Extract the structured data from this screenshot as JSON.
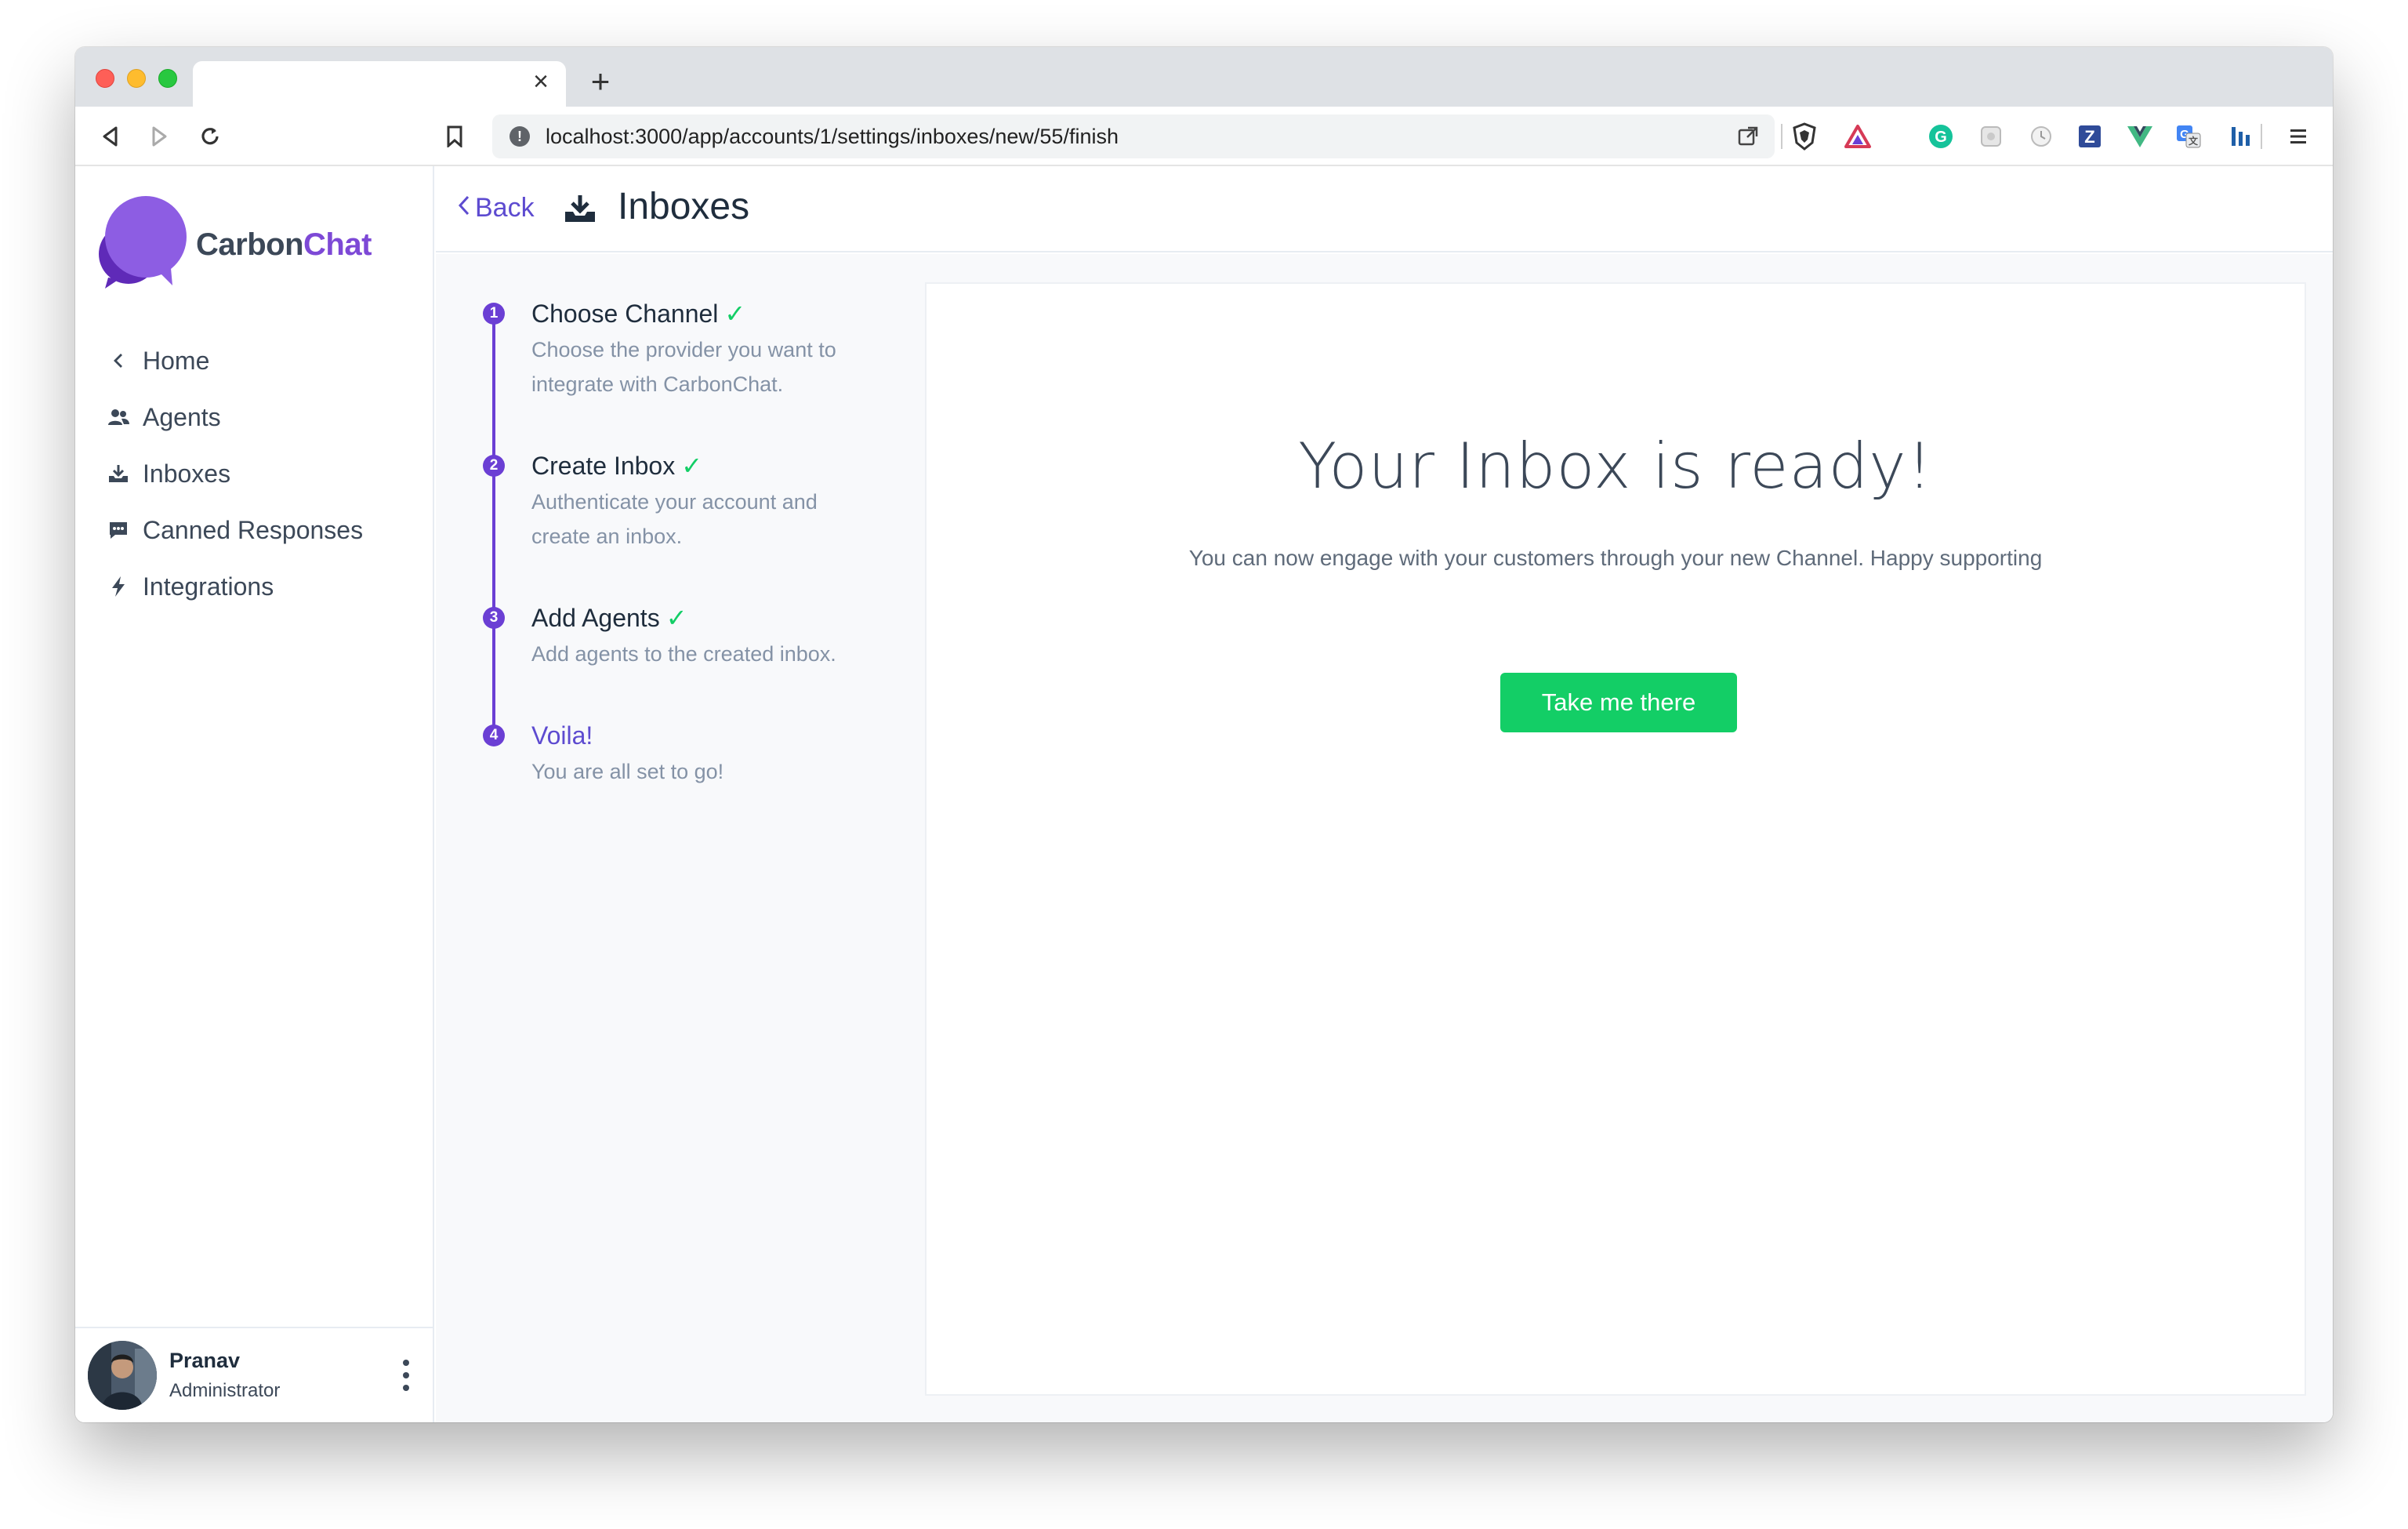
{
  "browser": {
    "url": "localhost:3000/app/accounts/1/settings/inboxes/new/55/finish",
    "tab_close": "×",
    "new_tab": "+"
  },
  "brand": {
    "name_part1": "Carbon",
    "name_part2": "Chat",
    "accent": "#7d49d6"
  },
  "sidebar": {
    "items": [
      {
        "label": "Home",
        "icon": "chevron-left-icon"
      },
      {
        "label": "Agents",
        "icon": "users-icon"
      },
      {
        "label": "Inboxes",
        "icon": "inbox-download-icon"
      },
      {
        "label": "Canned Responses",
        "icon": "chat-bubble-icon"
      },
      {
        "label": "Integrations",
        "icon": "lightning-icon"
      }
    ]
  },
  "profile": {
    "name": "Pranav",
    "role": "Administrator"
  },
  "header": {
    "back_label": "Back",
    "title": "Inboxes"
  },
  "steps": [
    {
      "number": "1",
      "title": "Choose Channel",
      "desc": "Choose the provider you want to integrate with CarbonChat.",
      "done": true
    },
    {
      "number": "2",
      "title": "Create Inbox",
      "desc": "Authenticate your account and create an inbox.",
      "done": true
    },
    {
      "number": "3",
      "title": "Add Agents",
      "desc": "Add agents to the created inbox.",
      "done": true
    },
    {
      "number": "4",
      "title": "Voila!",
      "desc": "You are all set to go!",
      "done": false
    }
  ],
  "finish": {
    "title": "Your Inbox is ready!",
    "subtitle": "You can now engage with your customers through your new Channel. Happy supporting",
    "button_label": "Take me there"
  },
  "colors": {
    "primary": "#5d4bd0",
    "step_purple": "#6b3fd4",
    "success": "#13ce66"
  }
}
